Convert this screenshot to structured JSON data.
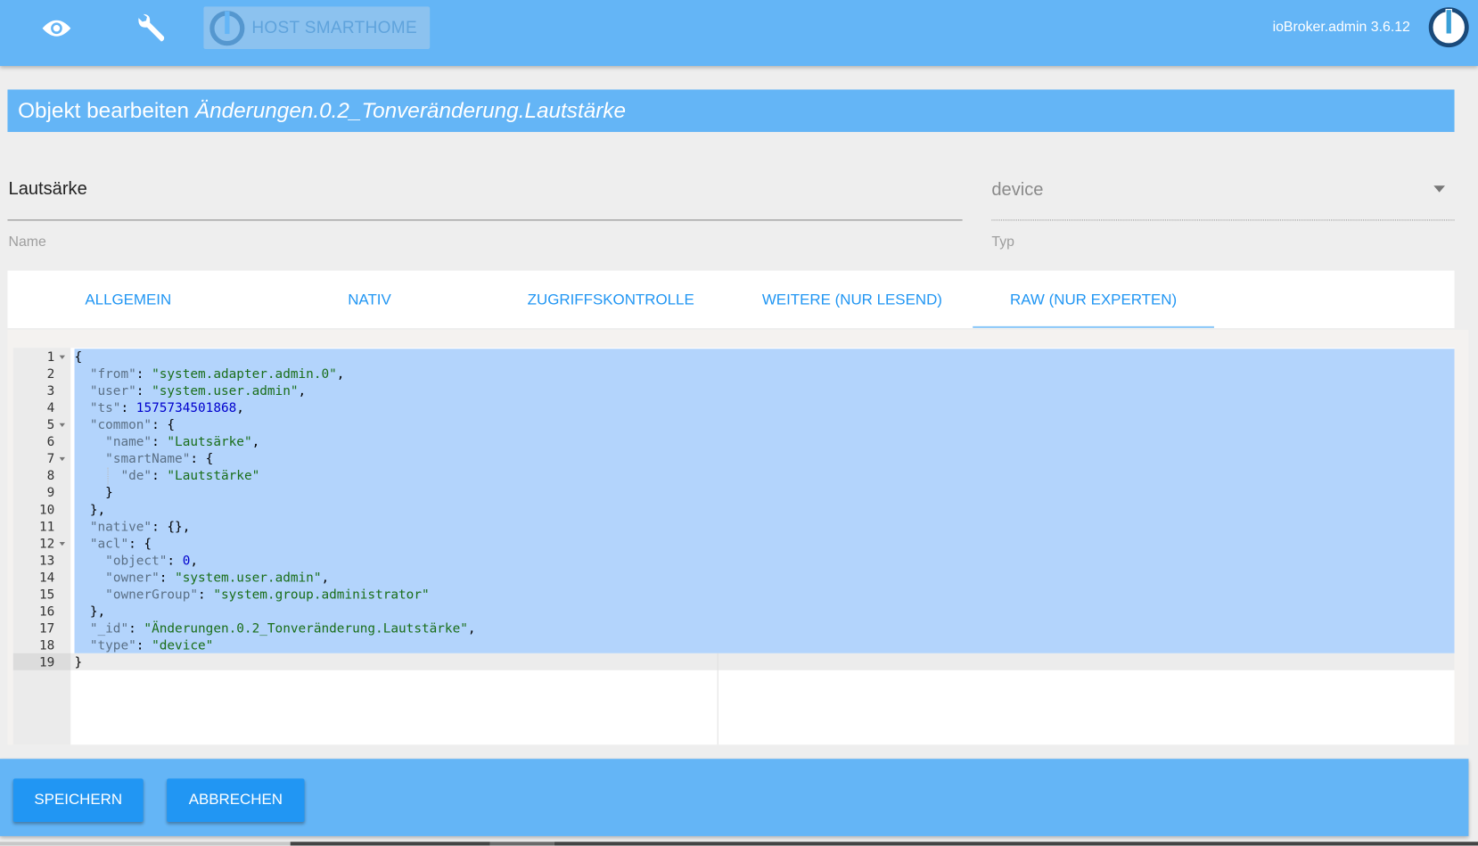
{
  "topbar": {
    "host_label": "HOST SMARTHOME",
    "version": "ioBroker.admin 3.6.12",
    "accent": "#64b5f6"
  },
  "dialog": {
    "title_prefix": "Objekt bearbeiten",
    "title_id": "Änderungen.0.2_Tonveränderung.Lautstärke",
    "name_value": "Lautsärke",
    "name_label": "Name",
    "type_value": "device",
    "type_label": "Typ"
  },
  "tabs": [
    {
      "label": "ALLGEMEIN"
    },
    {
      "label": "NATIV"
    },
    {
      "label": "ZUGRIFFSKONTROLLE"
    },
    {
      "label": "WEITERE (NUR LESEND)"
    },
    {
      "label": "RAW (NUR EXPERTEN)",
      "active": true
    }
  ],
  "editor": {
    "lines": [
      {
        "fold": true,
        "tokens": [
          [
            "p",
            "{"
          ]
        ]
      },
      {
        "tokens": [
          [
            "p",
            "  "
          ],
          [
            "k",
            "\"from\""
          ],
          [
            "p",
            ": "
          ],
          [
            "s",
            "\"system.adapter.admin.0\""
          ],
          [
            "p",
            ","
          ]
        ]
      },
      {
        "tokens": [
          [
            "p",
            "  "
          ],
          [
            "k",
            "\"user\""
          ],
          [
            "p",
            ": "
          ],
          [
            "s",
            "\"system.user.admin\""
          ],
          [
            "p",
            ","
          ]
        ]
      },
      {
        "tokens": [
          [
            "p",
            "  "
          ],
          [
            "k",
            "\"ts\""
          ],
          [
            "p",
            ": "
          ],
          [
            "n",
            "1575734501868"
          ],
          [
            "p",
            ","
          ]
        ]
      },
      {
        "fold": true,
        "tokens": [
          [
            "p",
            "  "
          ],
          [
            "k",
            "\"common\""
          ],
          [
            "p",
            ": {"
          ]
        ]
      },
      {
        "tokens": [
          [
            "p",
            "    "
          ],
          [
            "k",
            "\"name\""
          ],
          [
            "p",
            ": "
          ],
          [
            "s",
            "\"Lautsärke\""
          ],
          [
            "p",
            ","
          ]
        ]
      },
      {
        "fold": true,
        "tokens": [
          [
            "p",
            "    "
          ],
          [
            "k",
            "\"smartName\""
          ],
          [
            "p",
            ": {"
          ]
        ]
      },
      {
        "tokens": [
          [
            "p",
            "      "
          ],
          [
            "k",
            "\"de\""
          ],
          [
            "p",
            ": "
          ],
          [
            "s",
            "\"Lautstärke\""
          ]
        ]
      },
      {
        "tokens": [
          [
            "p",
            "    }"
          ]
        ]
      },
      {
        "tokens": [
          [
            "p",
            "  },"
          ]
        ]
      },
      {
        "tokens": [
          [
            "p",
            "  "
          ],
          [
            "k",
            "\"native\""
          ],
          [
            "p",
            ": {},"
          ]
        ]
      },
      {
        "fold": true,
        "tokens": [
          [
            "p",
            "  "
          ],
          [
            "k",
            "\"acl\""
          ],
          [
            "p",
            ": {"
          ]
        ]
      },
      {
        "tokens": [
          [
            "p",
            "    "
          ],
          [
            "k",
            "\"object\""
          ],
          [
            "p",
            ": "
          ],
          [
            "n",
            "0"
          ],
          [
            "p",
            ","
          ]
        ]
      },
      {
        "tokens": [
          [
            "p",
            "    "
          ],
          [
            "k",
            "\"owner\""
          ],
          [
            "p",
            ": "
          ],
          [
            "s",
            "\"system.user.admin\""
          ],
          [
            "p",
            ","
          ]
        ]
      },
      {
        "tokens": [
          [
            "p",
            "    "
          ],
          [
            "k",
            "\"ownerGroup\""
          ],
          [
            "p",
            ": "
          ],
          [
            "s",
            "\"system.group.administrator\""
          ]
        ]
      },
      {
        "tokens": [
          [
            "p",
            "  },"
          ]
        ]
      },
      {
        "tokens": [
          [
            "p",
            "  "
          ],
          [
            "k",
            "\"_id\""
          ],
          [
            "p",
            ": "
          ],
          [
            "s",
            "\"Änderungen.0.2_Tonveränderung.Lautstärke\""
          ],
          [
            "p",
            ","
          ]
        ]
      },
      {
        "tokens": [
          [
            "p",
            "  "
          ],
          [
            "k",
            "\"type\""
          ],
          [
            "p",
            ": "
          ],
          [
            "s",
            "\"device\""
          ]
        ]
      },
      {
        "tokens": [
          [
            "p",
            "}"
          ]
        ]
      }
    ]
  },
  "footer": {
    "save_label": "SPEICHERN",
    "cancel_label": "ABBRECHEN",
    "button_color": "#2196f3"
  }
}
